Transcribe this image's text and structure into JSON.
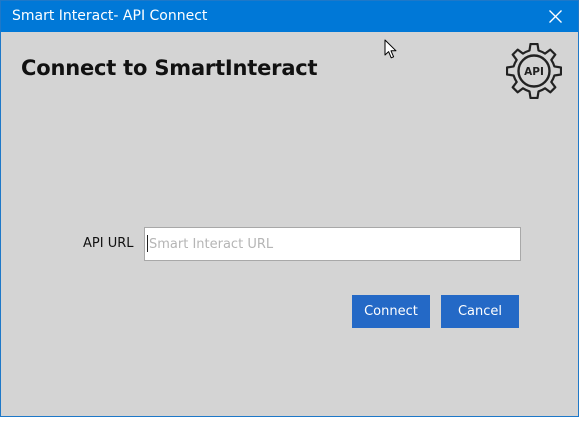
{
  "window": {
    "title": "Smart Interact- API Connect",
    "titlebar_color": "#0078d7",
    "background_color": "#d4d4d4"
  },
  "icons": {
    "close": "close-icon",
    "logo": "api-gear-icon",
    "pointer": "mouse-pointer-icon"
  },
  "main": {
    "heading": "Connect to SmartInteract",
    "logo_text": "API",
    "api_url": {
      "label": "API URL",
      "value": "",
      "placeholder": "Smart Interact URL"
    }
  },
  "buttons": {
    "connect_label": "Connect",
    "cancel_label": "Cancel",
    "color": "#2469c6"
  }
}
